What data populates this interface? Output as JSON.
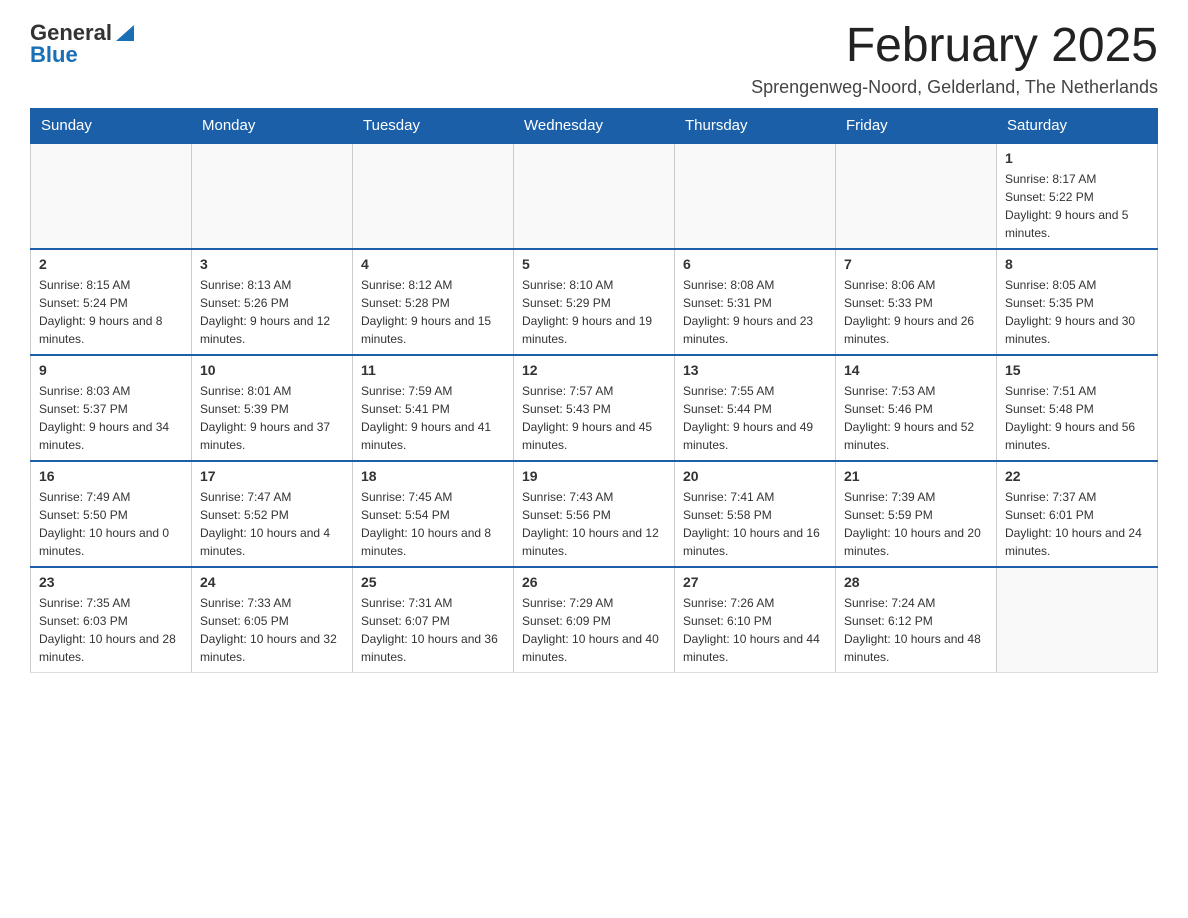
{
  "header": {
    "logo_general": "General",
    "logo_blue": "Blue",
    "title": "February 2025",
    "subtitle": "Sprengenweg-Noord, Gelderland, The Netherlands"
  },
  "days_of_week": [
    "Sunday",
    "Monday",
    "Tuesday",
    "Wednesday",
    "Thursday",
    "Friday",
    "Saturday"
  ],
  "weeks": [
    {
      "days": [
        {
          "number": "",
          "info": ""
        },
        {
          "number": "",
          "info": ""
        },
        {
          "number": "",
          "info": ""
        },
        {
          "number": "",
          "info": ""
        },
        {
          "number": "",
          "info": ""
        },
        {
          "number": "",
          "info": ""
        },
        {
          "number": "1",
          "info": "Sunrise: 8:17 AM\nSunset: 5:22 PM\nDaylight: 9 hours and 5 minutes."
        }
      ]
    },
    {
      "days": [
        {
          "number": "2",
          "info": "Sunrise: 8:15 AM\nSunset: 5:24 PM\nDaylight: 9 hours and 8 minutes."
        },
        {
          "number": "3",
          "info": "Sunrise: 8:13 AM\nSunset: 5:26 PM\nDaylight: 9 hours and 12 minutes."
        },
        {
          "number": "4",
          "info": "Sunrise: 8:12 AM\nSunset: 5:28 PM\nDaylight: 9 hours and 15 minutes."
        },
        {
          "number": "5",
          "info": "Sunrise: 8:10 AM\nSunset: 5:29 PM\nDaylight: 9 hours and 19 minutes."
        },
        {
          "number": "6",
          "info": "Sunrise: 8:08 AM\nSunset: 5:31 PM\nDaylight: 9 hours and 23 minutes."
        },
        {
          "number": "7",
          "info": "Sunrise: 8:06 AM\nSunset: 5:33 PM\nDaylight: 9 hours and 26 minutes."
        },
        {
          "number": "8",
          "info": "Sunrise: 8:05 AM\nSunset: 5:35 PM\nDaylight: 9 hours and 30 minutes."
        }
      ]
    },
    {
      "days": [
        {
          "number": "9",
          "info": "Sunrise: 8:03 AM\nSunset: 5:37 PM\nDaylight: 9 hours and 34 minutes."
        },
        {
          "number": "10",
          "info": "Sunrise: 8:01 AM\nSunset: 5:39 PM\nDaylight: 9 hours and 37 minutes."
        },
        {
          "number": "11",
          "info": "Sunrise: 7:59 AM\nSunset: 5:41 PM\nDaylight: 9 hours and 41 minutes."
        },
        {
          "number": "12",
          "info": "Sunrise: 7:57 AM\nSunset: 5:43 PM\nDaylight: 9 hours and 45 minutes."
        },
        {
          "number": "13",
          "info": "Sunrise: 7:55 AM\nSunset: 5:44 PM\nDaylight: 9 hours and 49 minutes."
        },
        {
          "number": "14",
          "info": "Sunrise: 7:53 AM\nSunset: 5:46 PM\nDaylight: 9 hours and 52 minutes."
        },
        {
          "number": "15",
          "info": "Sunrise: 7:51 AM\nSunset: 5:48 PM\nDaylight: 9 hours and 56 minutes."
        }
      ]
    },
    {
      "days": [
        {
          "number": "16",
          "info": "Sunrise: 7:49 AM\nSunset: 5:50 PM\nDaylight: 10 hours and 0 minutes."
        },
        {
          "number": "17",
          "info": "Sunrise: 7:47 AM\nSunset: 5:52 PM\nDaylight: 10 hours and 4 minutes."
        },
        {
          "number": "18",
          "info": "Sunrise: 7:45 AM\nSunset: 5:54 PM\nDaylight: 10 hours and 8 minutes."
        },
        {
          "number": "19",
          "info": "Sunrise: 7:43 AM\nSunset: 5:56 PM\nDaylight: 10 hours and 12 minutes."
        },
        {
          "number": "20",
          "info": "Sunrise: 7:41 AM\nSunset: 5:58 PM\nDaylight: 10 hours and 16 minutes."
        },
        {
          "number": "21",
          "info": "Sunrise: 7:39 AM\nSunset: 5:59 PM\nDaylight: 10 hours and 20 minutes."
        },
        {
          "number": "22",
          "info": "Sunrise: 7:37 AM\nSunset: 6:01 PM\nDaylight: 10 hours and 24 minutes."
        }
      ]
    },
    {
      "days": [
        {
          "number": "23",
          "info": "Sunrise: 7:35 AM\nSunset: 6:03 PM\nDaylight: 10 hours and 28 minutes."
        },
        {
          "number": "24",
          "info": "Sunrise: 7:33 AM\nSunset: 6:05 PM\nDaylight: 10 hours and 32 minutes."
        },
        {
          "number": "25",
          "info": "Sunrise: 7:31 AM\nSunset: 6:07 PM\nDaylight: 10 hours and 36 minutes."
        },
        {
          "number": "26",
          "info": "Sunrise: 7:29 AM\nSunset: 6:09 PM\nDaylight: 10 hours and 40 minutes."
        },
        {
          "number": "27",
          "info": "Sunrise: 7:26 AM\nSunset: 6:10 PM\nDaylight: 10 hours and 44 minutes."
        },
        {
          "number": "28",
          "info": "Sunrise: 7:24 AM\nSunset: 6:12 PM\nDaylight: 10 hours and 48 minutes."
        },
        {
          "number": "",
          "info": ""
        }
      ]
    }
  ]
}
